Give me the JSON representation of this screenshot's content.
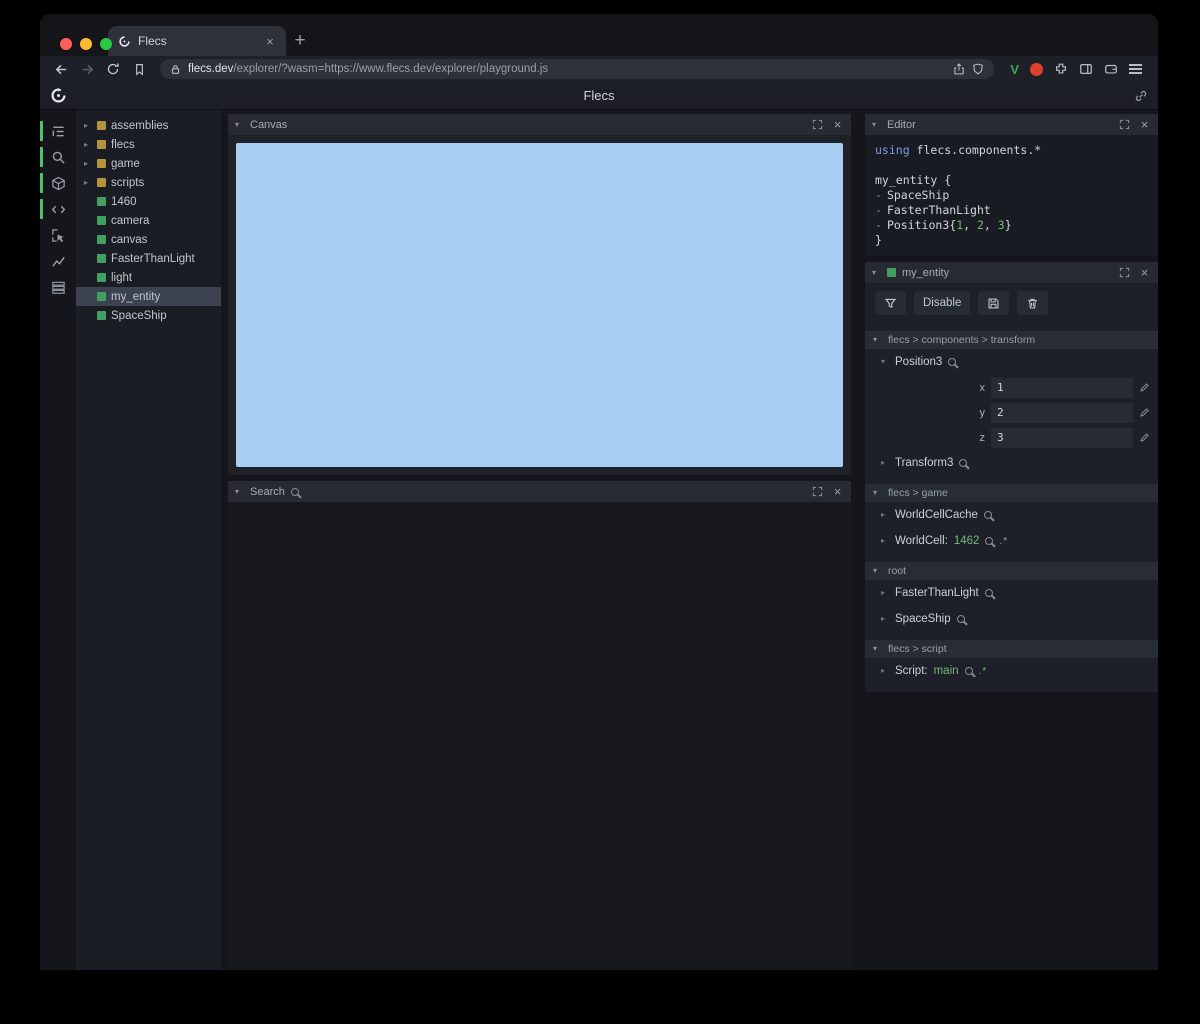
{
  "colors": {
    "accent_green": "#4cc26a",
    "module_yellow": "#b5923c",
    "entity_green": "#42a161",
    "canvas_blue": "#a7cdf1",
    "value_green": "#76b87a",
    "traffic_red": "#ff5f57",
    "traffic_yellow": "#febc2e",
    "traffic_green": "#28c840"
  },
  "glyphs": {
    "close": "×",
    "chev_down": "▾",
    "chev_right": "▸",
    "plus": "+",
    "pair": ".*",
    "ext_v": "V"
  },
  "browser": {
    "tab_title": "Flecs",
    "url_domain": "flecs.dev",
    "url_rest": "/explorer/?wasm=https://www.flecs.dev/explorer/playground.js"
  },
  "app": {
    "title": "Flecs"
  },
  "sidebar_icons": [
    {
      "name": "outline-tree-icon"
    },
    {
      "name": "search-icon"
    },
    {
      "name": "cube-icon"
    },
    {
      "name": "code-icon"
    },
    {
      "name": "inspect-cursor-icon"
    },
    {
      "name": "chart-icon"
    },
    {
      "name": "list-rows-icon"
    }
  ],
  "tree": {
    "items": [
      {
        "label": "assemblies",
        "type": "module"
      },
      {
        "label": "flecs",
        "type": "module"
      },
      {
        "label": "game",
        "type": "module"
      },
      {
        "label": "scripts",
        "type": "module"
      },
      {
        "label": "1460",
        "type": "entity"
      },
      {
        "label": "camera",
        "type": "entity"
      },
      {
        "label": "canvas",
        "type": "entity"
      },
      {
        "label": "FasterThanLight",
        "type": "entity"
      },
      {
        "label": "light",
        "type": "entity"
      },
      {
        "label": "my_entity",
        "type": "entity",
        "selected": true
      },
      {
        "label": "SpaceShip",
        "type": "entity"
      }
    ]
  },
  "panels": {
    "canvas": {
      "title": "Canvas"
    },
    "search": {
      "title": "Search"
    },
    "editor": {
      "title": "Editor"
    },
    "inspector": {
      "title": "my_entity",
      "disable_label": "Disable"
    }
  },
  "editor_code": {
    "kw": "using",
    "l1_rest": " flecs.components.*",
    "l3": "my_entity {",
    "dash": "-",
    "c1": "SpaceShip",
    "c2": "FasterThanLight",
    "c3_pre": "Position3{",
    "n1": "1",
    "sep1": ", ",
    "n2": "2",
    "sep2": ", ",
    "n3": "3",
    "c3_post": "}",
    "l7": "}"
  },
  "inspector": {
    "sections": [
      {
        "path": "flecs > components > transform"
      },
      {
        "path": "flecs > game"
      },
      {
        "path": "root"
      },
      {
        "path": "flecs > script"
      }
    ],
    "position3": {
      "name": "Position3",
      "fields": [
        {
          "k": "x",
          "v": "1"
        },
        {
          "k": "y",
          "v": "2"
        },
        {
          "k": "z",
          "v": "3"
        }
      ]
    },
    "transform3": "Transform3",
    "worldcellcache": "WorldCellCache",
    "worldcell_label": "WorldCell:",
    "worldcell_value": "1462",
    "root_1": "FasterThanLight",
    "root_2": "SpaceShip",
    "script_label": "Script:",
    "script_value": "main"
  }
}
